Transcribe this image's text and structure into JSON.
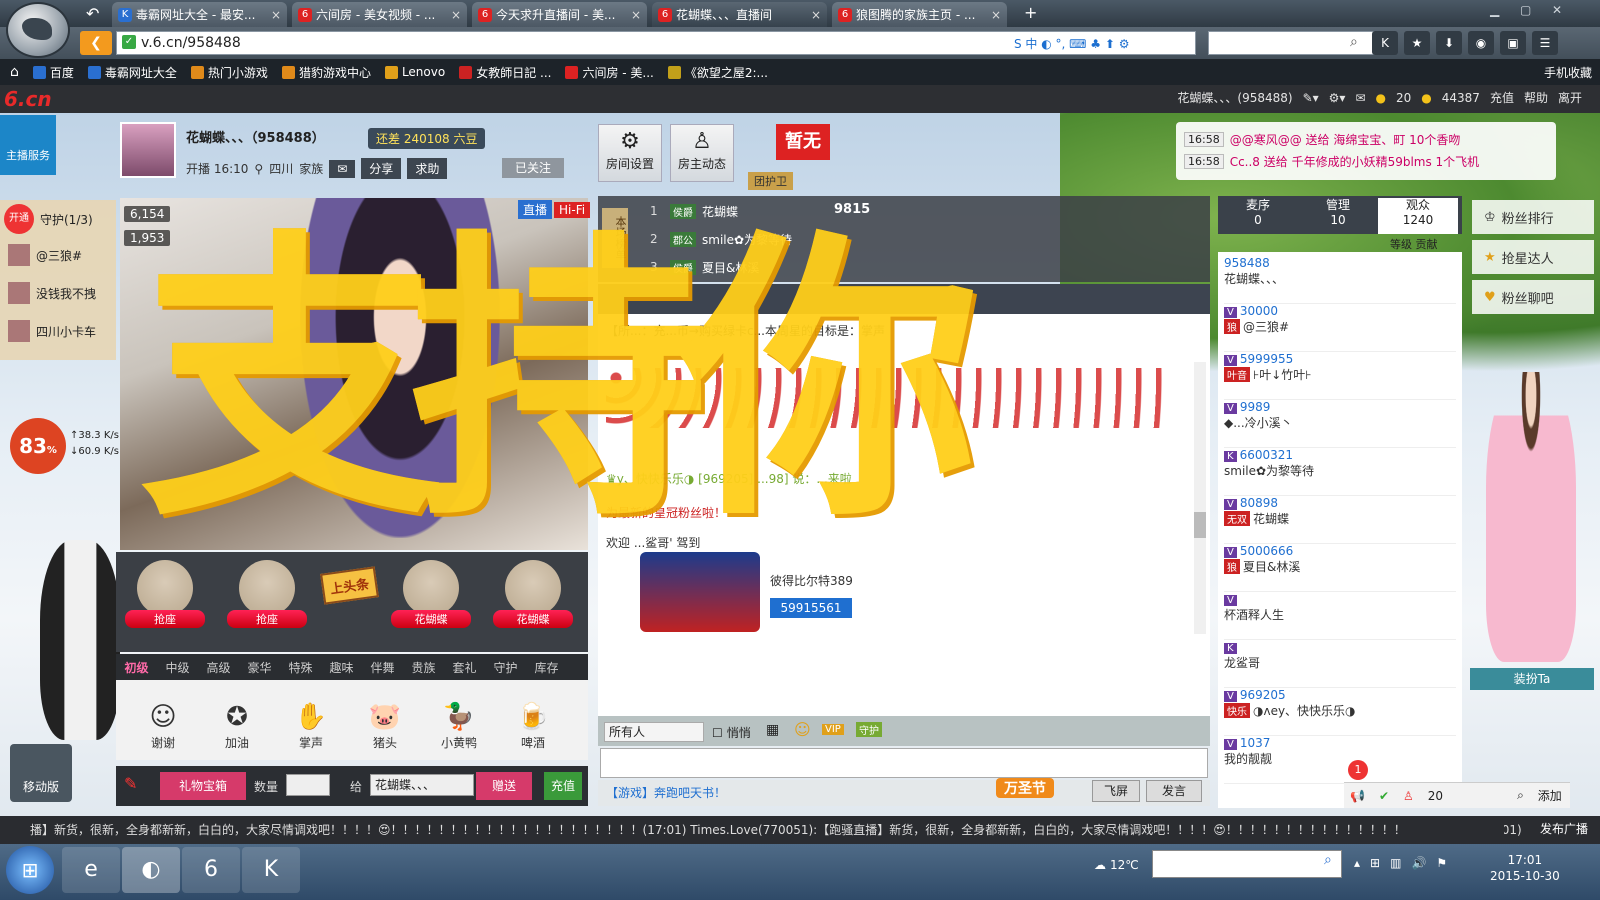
{
  "browser": {
    "tabs": [
      {
        "title": "毒霸网址大全 - 最安...",
        "icon": "K",
        "color": "#2a6fd0"
      },
      {
        "title": "六间房 - 美女视频 - ...",
        "icon": "6",
        "color": "#d22"
      },
      {
        "title": "今天求升直播间 - 美...",
        "icon": "6",
        "color": "#d22"
      },
      {
        "title": "花蝴蝶、、、直播间",
        "icon": "6",
        "color": "#d22"
      },
      {
        "title": "狼图腾的家族主页 - ...",
        "icon": "6",
        "color": "#d22"
      }
    ],
    "new_tab_label": "+",
    "close_glyph": "×",
    "url": "v.6.cn/958488",
    "ime_label": "S 中 ◐ °, ⌨ ♣ ⬆ ⚙",
    "bookmarks": [
      {
        "label": "百度",
        "color": "#2a6fd0"
      },
      {
        "label": "毒霸网址大全",
        "color": "#2a6fd0"
      },
      {
        "label": "热门小游戏",
        "color": "#e08a1a"
      },
      {
        "label": "猎豹游戏中心",
        "color": "#e08a1a"
      },
      {
        "label": "Lenovo",
        "color": "#e0a01a"
      },
      {
        "label": "女教師日記 ...",
        "color": "#c22"
      },
      {
        "label": "六间房 - 美...",
        "color": "#d22"
      },
      {
        "label": "《欲望之屋2:...",
        "color": "#c2a01a"
      }
    ],
    "mobile_fav": "手机收藏"
  },
  "site": {
    "logo": "6.cn",
    "user": "花蝴蝶、、、(958488)",
    "coins": "20",
    "beans": "44387",
    "nav": [
      "充值",
      "帮助",
      "离开"
    ]
  },
  "host": {
    "name": "花蝴蝶、、、（958488）",
    "score_label": "还差 240108 六豆",
    "start_time": "开播 16:10",
    "location": "四川",
    "family_label": "家族",
    "buttons": [
      "分享",
      "求助"
    ],
    "follow": "已关注"
  },
  "room_buttons": [
    "房间设置",
    "房主动态"
  ],
  "zanwu": "暂无",
  "guard_tag": "团护卫",
  "ticker": [
    {
      "time": "16:58",
      "text": "@@寒风@@ 送给 海绵宝宝、町 10个香吻"
    },
    {
      "time": "16:58",
      "text": "Cc..8 送给 千年修成的小妖精59blms 1个飞机"
    }
  ],
  "left": {
    "service": "主播服务",
    "open": "开通",
    "guard_title": "守护(1/3)",
    "guards": [
      "@三狼#",
      "没钱我不拽",
      "四川小卡车"
    ],
    "speed_pct": "83",
    "speed_unit": "%",
    "up_rate": "↑38.3 K/s",
    "down_rate": "↓60.9 K/s",
    "mobile": "移动版"
  },
  "video": {
    "badge_live": "直播",
    "badge_hifi": "Hi-Fi",
    "stat1": "6,154",
    "stat2": "1,953",
    "overlay_text": "支持你"
  },
  "seats": [
    "抢座",
    "抢座",
    "花蝴蝶",
    "花蝴蝶"
  ],
  "headline": "上头条",
  "gift_tabs": [
    "初级",
    "中级",
    "高级",
    "豪华",
    "特殊",
    "趣味",
    "伴舞",
    "贵族",
    "套礼",
    "守护",
    "库存"
  ],
  "gifts": [
    {
      "name": "谢谢",
      "icon": "☺"
    },
    {
      "name": "加油",
      "icon": "✪"
    },
    {
      "name": "掌声",
      "icon": "✋"
    },
    {
      "name": "猪头",
      "icon": "🐷"
    },
    {
      "name": "小黄鸭",
      "icon": "🦆"
    },
    {
      "name": "啤酒",
      "icon": "🍺"
    }
  ],
  "gift_bar": {
    "treasure": "礼物宝箱",
    "qty": "数量",
    "give": "给",
    "recipient": "花蝴蝶、、、",
    "send": "赠送",
    "recharge": "充值"
  },
  "rank": {
    "label": "本场榜单",
    "rows": [
      {
        "no": "1",
        "tag": "侯爵",
        "name": "花蝴蝶"
      },
      {
        "no": "2",
        "tag": "郡公",
        "name": "smile✿为黎等待"
      },
      {
        "no": "3",
        "tag": "侯爵",
        "name": "夏目&林溪"
      }
    ],
    "score": "9815"
  },
  "chat": {
    "notice": "【所...：充...币→购买绿卡c...本周星的目标是：掌声",
    "line2": "♛y、快快乐乐◑ [969205] ...98] 说：...来啦",
    "line3": "为最新的皇冠粉丝啦！",
    "welcome": "欢迎 ...鲨哥' 驾到",
    "truck_user": "彼得比尔特389",
    "truck_num": "59915561",
    "to": "所有人",
    "whisper": "悄悄",
    "game_link": "【游戏】奔跑吧天书！",
    "halloween": "万圣节",
    "fly": "飞屏",
    "send": "发言"
  },
  "audience": {
    "tabs": [
      {
        "label": "麦序",
        "count": "0"
      },
      {
        "label": "管理",
        "count": "10"
      },
      {
        "label": "观众",
        "count": "1240"
      }
    ],
    "sort": "等级 贡献",
    "list": [
      {
        "num": "958488",
        "tag": "",
        "name": "花蝴蝶、、、"
      },
      {
        "num": "30000",
        "tag": "狼",
        "name": "@三狼#"
      },
      {
        "num": "5999955",
        "tag": "叶音",
        "name": "⊦叶↓竹叶⊦"
      },
      {
        "num": "9989",
        "tag": "",
        "name": "◆...冷小溪丶"
      },
      {
        "num": "6600321",
        "tag": "",
        "name": "smile✿为黎等待"
      },
      {
        "num": "80898",
        "tag": "无双",
        "name": "花蝴蝶"
      },
      {
        "num": "5000666",
        "tag": "狼",
        "name": "夏目&林溪"
      },
      {
        "num": "",
        "tag": "",
        "name": "杯酒释人生"
      },
      {
        "num": "",
        "tag": "",
        "name": "龙鲨哥"
      },
      {
        "num": "969205",
        "tag": "快乐",
        "name": "◑ʌey、快快乐乐◑"
      },
      {
        "num": "1037",
        "tag": "",
        "name": "我的靓靓"
      }
    ],
    "notif": "1",
    "online": "20",
    "add": "添加"
  },
  "far_right": {
    "buttons": [
      "粉丝排行",
      "抢星达人",
      "粉丝聊吧"
    ],
    "dress": "装扮Ta"
  },
  "marquee": {
    "text": "播】新货，很新，全身都新新，白白的，大家尽情调戏吧！！！！😍！！！！！！！！！！！！！！！！！！！！！(17:01)   Times.Love(770051):【跑骚直播】新货，很新，全身都新新，白白的，大家尽情调戏吧！！！！😍！！！！！！！！！！！！！！！！！！！！！(17:01)",
    "broadcast": "发布广播"
  },
  "taskbar": {
    "weather": "12℃",
    "time": "17:01",
    "date": "2015-10-30"
  }
}
